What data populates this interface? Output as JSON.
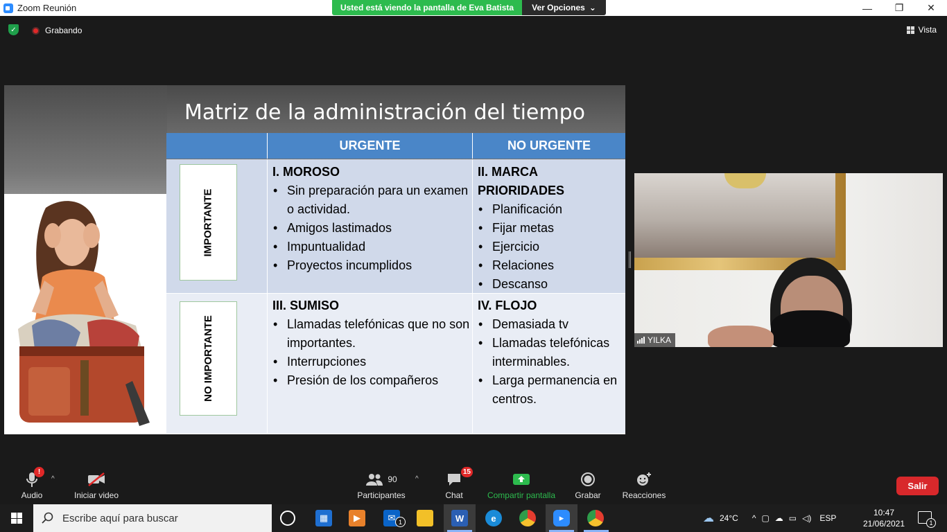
{
  "window": {
    "title": "Zoom Reunión",
    "min": "—",
    "restore": "❐",
    "close": "✕"
  },
  "share_banner": {
    "viewing_text": "Usted está viendo la pantalla de Eva Batista",
    "options_label": "Ver Opciones"
  },
  "meeting": {
    "recording_label": "Grabando",
    "view_label": "Vista"
  },
  "slide": {
    "title": "Matriz de  la administración del tiempo",
    "col_headers": [
      "URGENTE",
      "NO URGENTE"
    ],
    "row_labels": [
      "IMPORTANTE",
      "NO IMPORTANTE"
    ],
    "q1": {
      "title": "I. MOROSO",
      "items": [
        "Sin preparación para un examen o actividad.",
        "Amigos lastimados",
        "Impuntualidad",
        "Proyectos incumplidos"
      ]
    },
    "q2": {
      "title": "II. MARCA PRIORIDADES",
      "items": [
        "Planificación",
        "Fijar metas",
        "Ejercicio",
        "Relaciones",
        "Descanso"
      ]
    },
    "q3": {
      "title": "III. SUMISO",
      "items": [
        "Llamadas telefónicas que no son importantes.",
        "Interrupciones",
        "Presión de los compañeros"
      ]
    },
    "q4": {
      "title": "IV. FLOJO",
      "items": [
        "Demasiada tv",
        "Llamadas telefónicas interminables.",
        "Larga permanencia en centros."
      ]
    }
  },
  "video": {
    "participant_name": "YILKA"
  },
  "toolbar": {
    "audio_label": "Audio",
    "audio_badge": "!",
    "video_label": "Iniciar video",
    "participants_label": "Participantes",
    "participants_count": "90",
    "chat_label": "Chat",
    "chat_badge": "15",
    "share_label": "Compartir pantalla",
    "record_label": "Grabar",
    "reactions_label": "Reacciones",
    "leave_label": "Salir"
  },
  "taskbar": {
    "search_placeholder": "Escribe aquí para buscar",
    "mail_badge": "1",
    "weather": "24°C",
    "language": "ESP",
    "time": "10:47",
    "date": "21/06/2021",
    "notifications_count": "1"
  }
}
